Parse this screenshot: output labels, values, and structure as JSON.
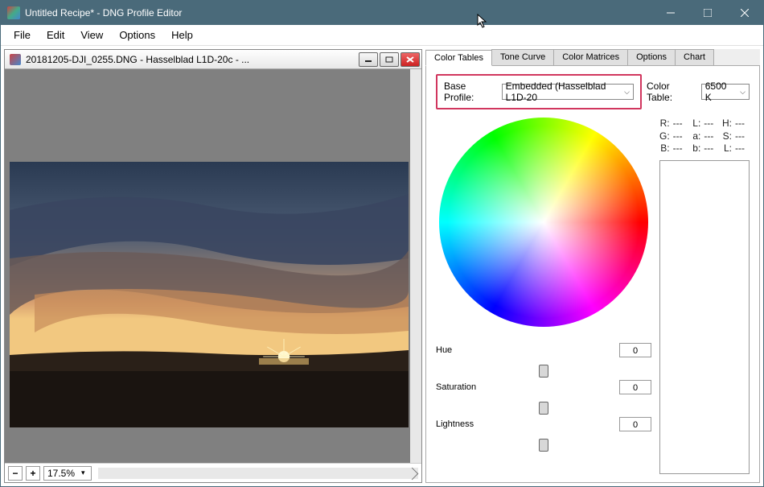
{
  "window": {
    "title": "Untitled Recipe* - DNG Profile Editor"
  },
  "menubar": [
    "File",
    "Edit",
    "View",
    "Options",
    "Help"
  ],
  "document": {
    "title": "20181205-DJI_0255.DNG  - Hasselblad L1D-20c - ..."
  },
  "zoom": {
    "level": "17.5%"
  },
  "tabs": [
    "Color Tables",
    "Tone Curve",
    "Color Matrices",
    "Options",
    "Chart"
  ],
  "active_tab": 0,
  "base_profile": {
    "label": "Base Profile:",
    "value": "Embedded (Hasselblad L1D-20"
  },
  "color_table": {
    "label": "Color Table:",
    "value": "6500 K"
  },
  "readouts": {
    "R": "---",
    "G": "---",
    "B": "---",
    "L": "---",
    "a": "---",
    "b": "---",
    "H": "---",
    "S": "---",
    "L2": "---"
  },
  "sliders": {
    "hue": {
      "label": "Hue",
      "value": "0"
    },
    "saturation": {
      "label": "Saturation",
      "value": "0"
    },
    "lightness": {
      "label": "Lightness",
      "value": "0"
    }
  }
}
